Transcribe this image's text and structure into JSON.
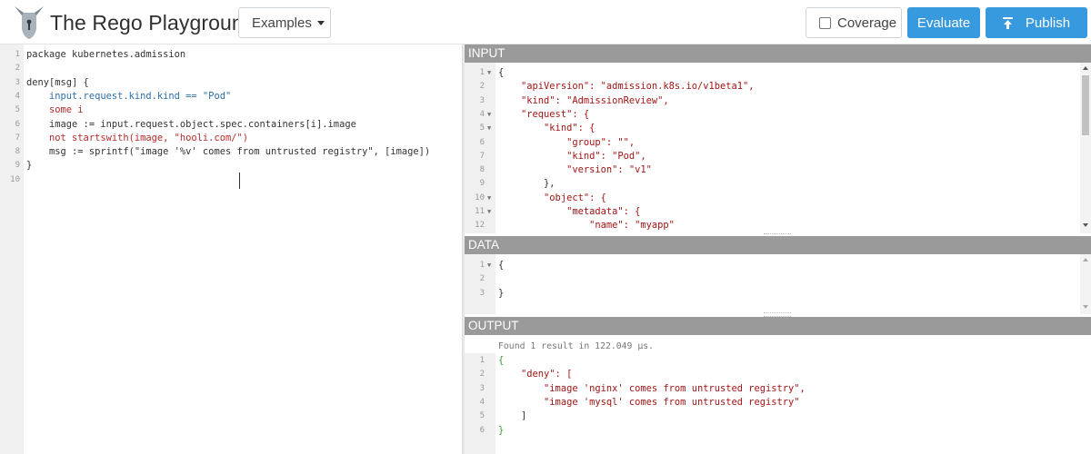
{
  "header": {
    "title": "The Rego Playground",
    "examples_label": "Examples",
    "coverage_label": "Coverage",
    "evaluate_label": "Evaluate",
    "publish_label": "Publish"
  },
  "colors": {
    "accent": "#3799de",
    "pane_header": "#9a9a9a",
    "keyword": "#b52b2b",
    "string": "#b22222"
  },
  "editor": {
    "line_numbers": [
      "1",
      "2",
      "3",
      "4",
      "5",
      "6",
      "7",
      "8",
      "9",
      "10"
    ],
    "lines": [
      "package kubernetes.admission",
      "",
      "deny[msg] {",
      "    input.request.kind.kind == \"Pod\"",
      "    some i",
      "    image := input.request.object.spec.containers[i].image",
      "    not startswith(image, \"hooli.com/\")",
      "    msg := sprintf(\"image '%v' comes from untrusted registry\", [image])",
      "}",
      ""
    ]
  },
  "input": {
    "header": "INPUT",
    "line_numbers": [
      "1",
      "2",
      "3",
      "4",
      "5",
      "6",
      "7",
      "8",
      "9",
      "10",
      "11",
      "12"
    ],
    "lines": [
      "{",
      "    \"apiVersion\": \"admission.k8s.io/v1beta1\",",
      "    \"kind\": \"AdmissionReview\",",
      "    \"request\": {",
      "        \"kind\": {",
      "            \"group\": \"\",",
      "            \"kind\": \"Pod\",",
      "            \"version\": \"v1\"",
      "        },",
      "        \"object\": {",
      "            \"metadata\": {",
      "                \"name\": \"myapp\""
    ]
  },
  "data": {
    "header": "DATA",
    "line_numbers": [
      "1",
      "2",
      "3"
    ],
    "lines": [
      "{",
      "",
      "}"
    ]
  },
  "output": {
    "header": "OUTPUT",
    "status": "Found 1 result in 122.049 µs.",
    "line_numbers": [
      "1",
      "2",
      "3",
      "4",
      "5",
      "6"
    ],
    "lines": [
      "{",
      "    \"deny\": [",
      "        \"image 'nginx' comes from untrusted registry\",",
      "        \"image 'mysql' comes from untrusted registry\"",
      "    ]",
      "}"
    ]
  },
  "icons": [
    "opa-logo-icon",
    "caret-down-icon",
    "checkbox-icon",
    "upload-icon",
    "fold-arrow-icon"
  ]
}
